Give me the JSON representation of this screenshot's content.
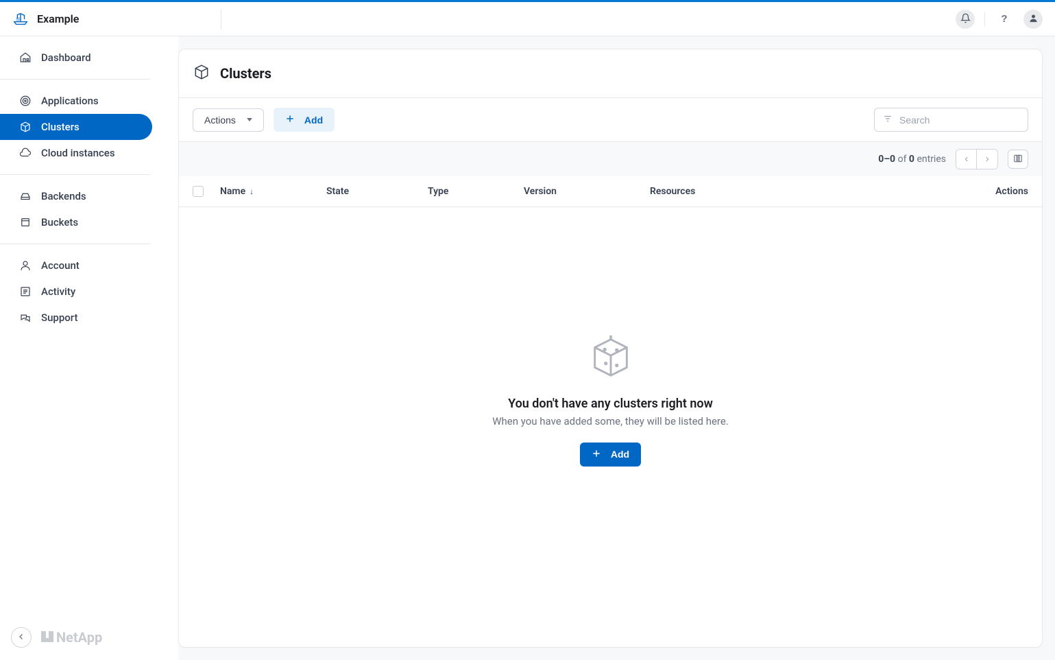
{
  "brand": "Example",
  "sidebar": {
    "items": [
      {
        "label": "Dashboard"
      },
      {
        "label": "Applications"
      },
      {
        "label": "Clusters"
      },
      {
        "label": "Cloud instances"
      },
      {
        "label": "Backends"
      },
      {
        "label": "Buckets"
      },
      {
        "label": "Account"
      },
      {
        "label": "Activity"
      },
      {
        "label": "Support"
      }
    ],
    "footer_brand": "NetApp"
  },
  "page": {
    "title": "Clusters",
    "actions_label": "Actions",
    "add_label": "Add",
    "search_placeholder": "Search",
    "meta": {
      "range": "0–0",
      "of": "of",
      "total": "0",
      "entries": "entries"
    },
    "columns": {
      "name": "Name",
      "state": "State",
      "type": "Type",
      "version": "Version",
      "resources": "Resources",
      "actions": "Actions"
    },
    "empty": {
      "title": "You don't have any clusters right now",
      "subtitle": "When you have added some, they will be listed here.",
      "button": "Add"
    }
  }
}
